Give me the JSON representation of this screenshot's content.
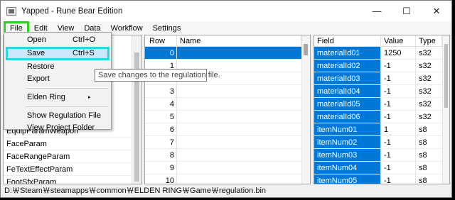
{
  "window": {
    "title": "Yapped - Rune Bear Edition",
    "minimize": "—",
    "maximize": "☐",
    "close": "✕"
  },
  "menubar": {
    "items": [
      "File",
      "Edit",
      "View",
      "Data",
      "Workflow",
      "Settings"
    ]
  },
  "file_menu": {
    "open": {
      "label": "Open",
      "shortcut": "Ctrl+O"
    },
    "save": {
      "label": "Save",
      "shortcut": "Ctrl+S"
    },
    "restore": "Restore",
    "export": "Export",
    "game": "Elden Ring",
    "game_arrow": "▸",
    "show_regulation": "Show Regulation File",
    "view_project": "View Project Folder"
  },
  "tooltip": "Save changes to the regulation file.",
  "left_pane": {
    "params": [
      "EquipParamWeapon",
      "FaceParam",
      "FaceRangeParam",
      "FeTextEffectParam",
      "FootSfxParam"
    ]
  },
  "mid_pane": {
    "headers": {
      "row": "Row",
      "name": "Name"
    },
    "rows": [
      "0",
      "1",
      "2",
      "3",
      "4",
      "5",
      "6",
      "7",
      "8",
      "9",
      "10"
    ]
  },
  "right_pane": {
    "headers": {
      "field": "Field",
      "value": "Value",
      "type": "Type"
    },
    "rows": [
      {
        "field": "materialId01",
        "value": "1250",
        "type": "s32"
      },
      {
        "field": "materialId02",
        "value": "-1",
        "type": "s32"
      },
      {
        "field": "materialId03",
        "value": "-1",
        "type": "s32"
      },
      {
        "field": "materialId04",
        "value": "-1",
        "type": "s32"
      },
      {
        "field": "materialId05",
        "value": "-1",
        "type": "s32"
      },
      {
        "field": "materialId06",
        "value": "-1",
        "type": "s32"
      },
      {
        "field": "itemNum01",
        "value": "1",
        "type": "s8"
      },
      {
        "field": "itemNum02",
        "value": "-1",
        "type": "s8"
      },
      {
        "field": "itemNum03",
        "value": "-1",
        "type": "s8"
      },
      {
        "field": "itemNum04",
        "value": "-1",
        "type": "s8"
      },
      {
        "field": "itemNum05",
        "value": "-1",
        "type": "s8"
      }
    ]
  },
  "statusbar": {
    "path": "D:￦Steam￦steamapps￦common￦ELDEN RING￦Game￦regulation.bin"
  },
  "colors": {
    "selection": "#0078d7",
    "file_highlight": "#29d419",
    "save_highlight": "#29d6e4"
  }
}
